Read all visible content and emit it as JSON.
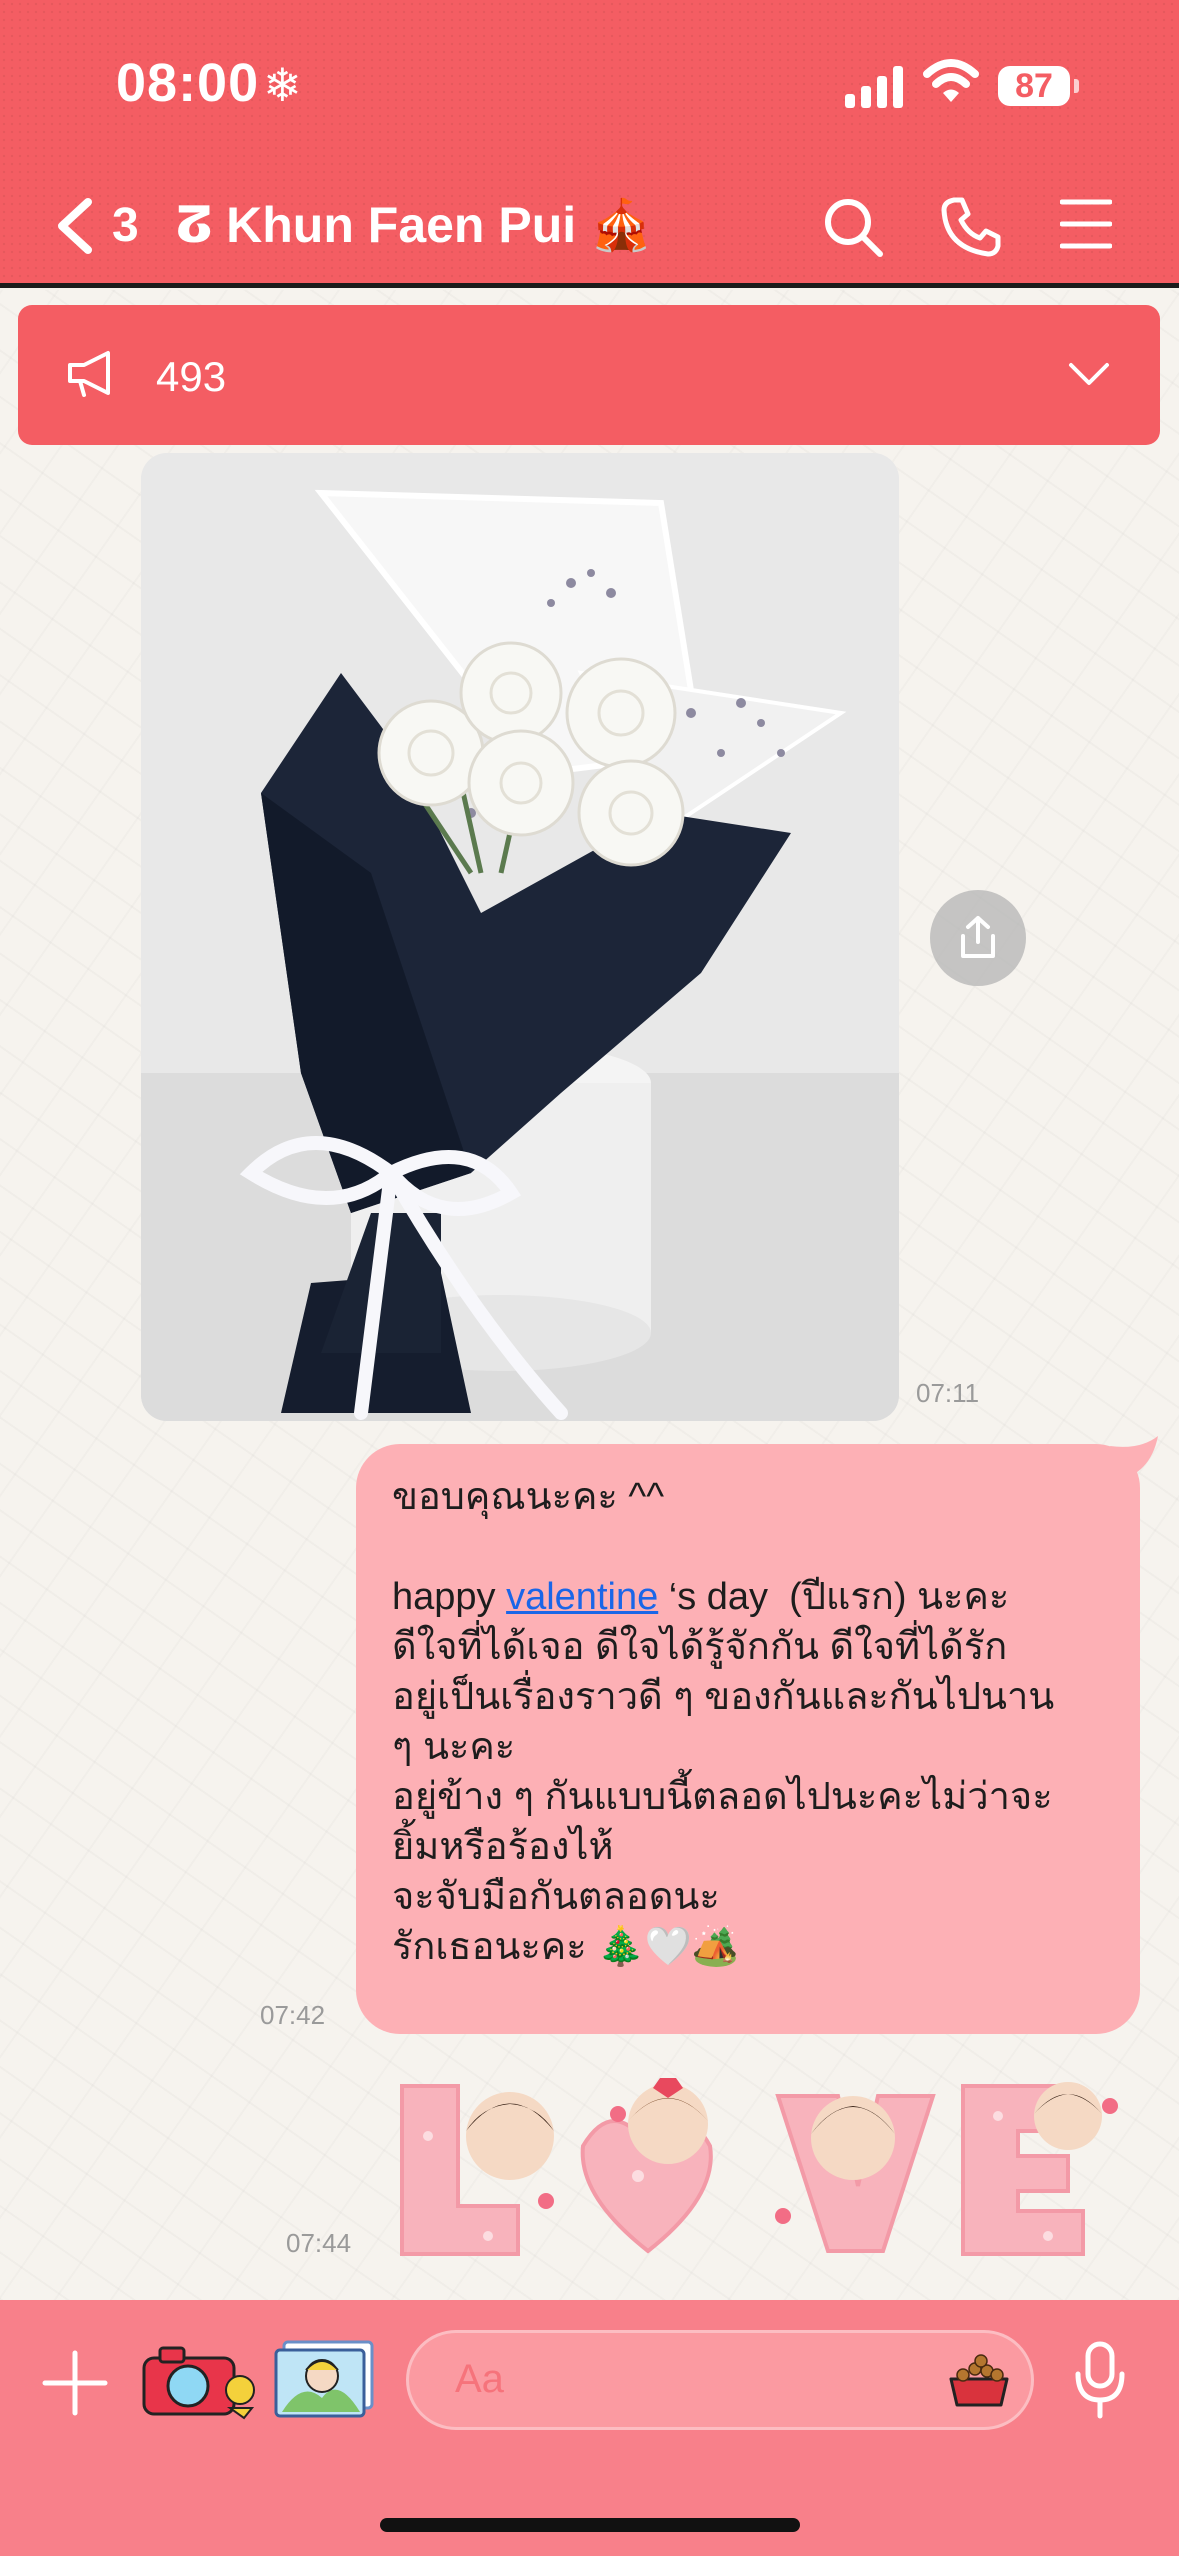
{
  "status_bar": {
    "time": "08:00",
    "battery": "87"
  },
  "header": {
    "unread_count": "3",
    "chat_name": "ⵒ Khun Faen Pui 🎪"
  },
  "announcement": {
    "count": "493"
  },
  "messages": [
    {
      "type": "image",
      "time": "07:11"
    },
    {
      "type": "text",
      "time": "07:42",
      "lines": {
        "l1": "ขอบคุณนะคะ ^^",
        "l2_pre": "happy ",
        "l2_link": "valentine",
        "l2_post": " ‘s day  (ปีแรก) นะคะ",
        "l3": "ดีใจที่ได้เจอ ดีใจได้รู้จักกัน ดีใจที่ได้รัก",
        "l4": "อยู่เป็นเรื่องราวดี ๆ ของกันและกันไปนาน",
        "l5": "ๆ นะคะ",
        "l6": "อยู่ข้าง ๆ กันแบบนี้ตลอดไปนะคะไม่ว่าจะ",
        "l7": "ยิ้มหรือร้องไห้",
        "l8": "จะจับมือกันตลอดนะ",
        "l9": "รักเธอนะคะ 🎄🤍🏕️"
      }
    },
    {
      "type": "sticker",
      "time": "07:44",
      "letters": [
        "L",
        "O",
        "V",
        "E"
      ]
    }
  ],
  "composer": {
    "placeholder": "Aa"
  },
  "colors": {
    "header": "#f45d63",
    "bubble": "#fdb0b5",
    "link": "#1a66e8",
    "bottom_bar": "#f8808a"
  }
}
